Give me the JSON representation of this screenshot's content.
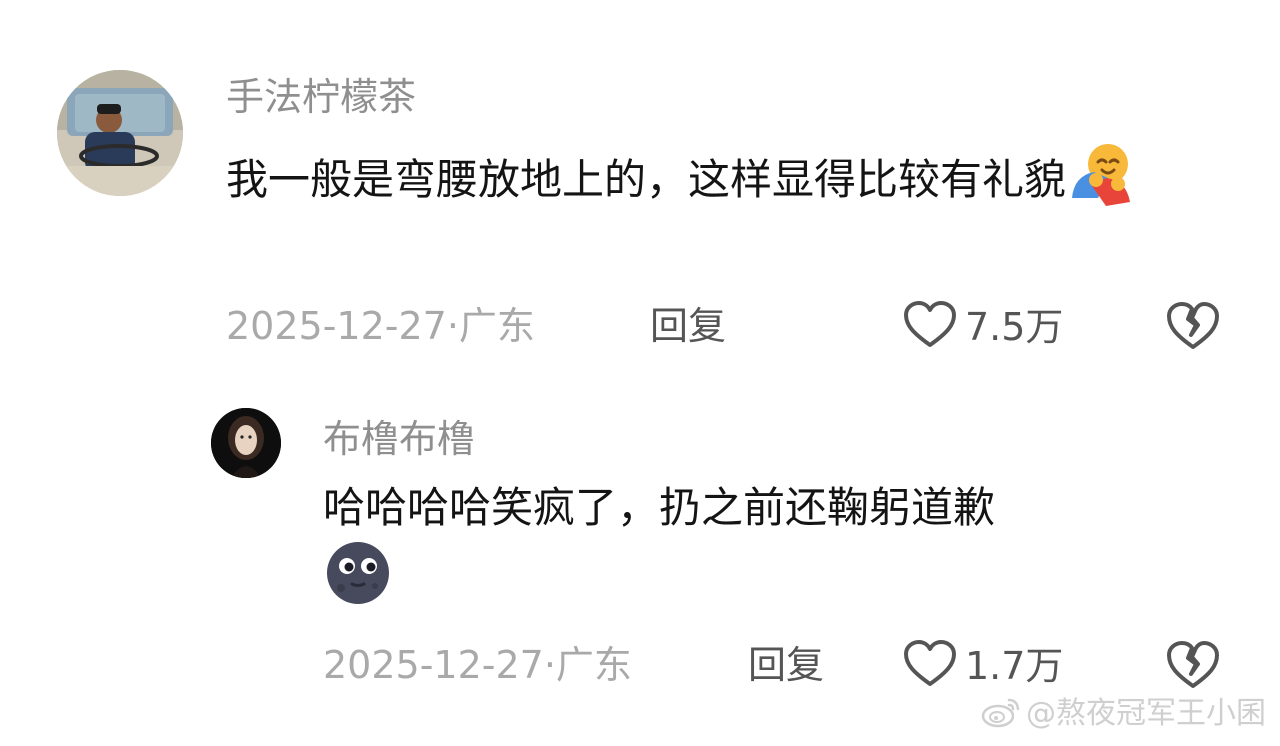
{
  "comments": {
    "main": {
      "username": "手法柠檬茶",
      "text": "我一般是弯腰放地上的，这样显得比较有礼貌",
      "emoji": "smiling-face-with-hearts-hugging-emoji",
      "date_location": "2025-12-27·广东",
      "reply_label": "回复",
      "like_count": "7.5万"
    },
    "reply": {
      "username": "布橹布橹",
      "text": "哈哈哈哈笑疯了，扔之前还鞠躬道歉",
      "emoji": "new-moon-face-emoji",
      "date_location": "2025-12-27·广东",
      "reply_label": "回复",
      "like_count": "1.7万"
    }
  },
  "watermark": {
    "text": "@熬夜冠军王小囷"
  },
  "colors": {
    "username": "#8f8f8f",
    "content": "#141414",
    "meta": "#a9a9a9",
    "action": "#555555",
    "watermark": "#cfcfcf"
  }
}
